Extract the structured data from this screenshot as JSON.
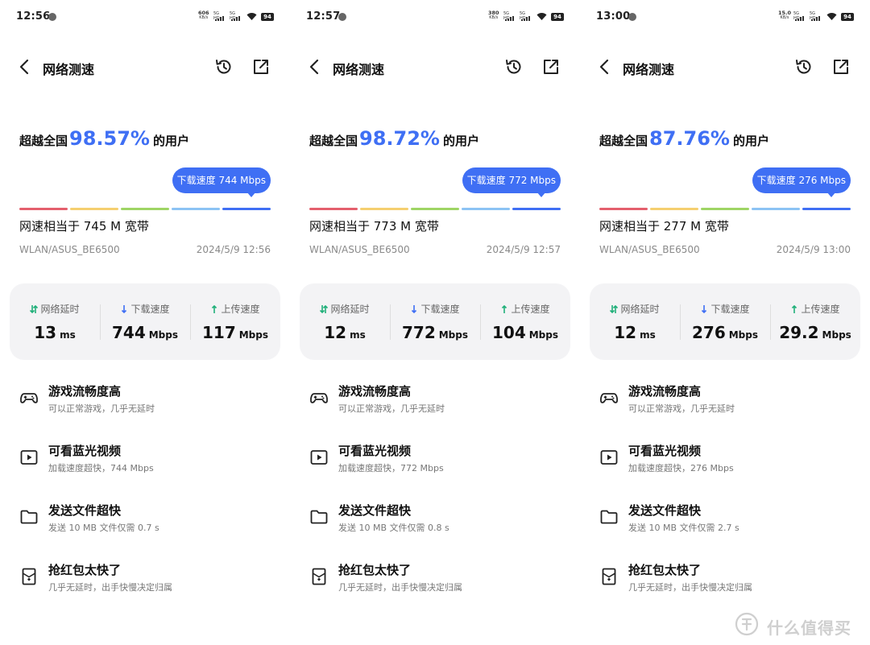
{
  "panels": [
    {
      "status": {
        "time": "12:56",
        "net_speed": "606",
        "net_unit": "KB/s",
        "battery": "94"
      },
      "header": {
        "title": "网络测速"
      },
      "headline": {
        "prefix": "超越全国",
        "percent": "98.57%",
        "suffix": "的用户"
      },
      "bubble": "下载速度 744 Mbps",
      "bandwidth": "网速相当于 745 M 宽带",
      "network": "WLAN/ASUS_BE6500",
      "datetime": "2024/5/9 12:56",
      "stats": {
        "latency_label": "网络延时",
        "latency_value": "13",
        "latency_unit": "ms",
        "download_label": "下载速度",
        "download_value": "744",
        "download_unit": "Mbps",
        "upload_label": "上传速度",
        "upload_value": "117",
        "upload_unit": "Mbps"
      },
      "features": [
        {
          "title": "游戏流畅度高",
          "subtitle": "可以正常游戏，几乎无延时"
        },
        {
          "title": "可看蓝光视频",
          "subtitle": "加载速度超快，744 Mbps"
        },
        {
          "title": "发送文件超快",
          "subtitle": "发送 10 MB 文件仅需 0.7 s"
        },
        {
          "title": "抢红包太快了",
          "subtitle": "几乎无延时，出手快慢决定归属"
        }
      ]
    },
    {
      "status": {
        "time": "12:57",
        "net_speed": "380",
        "net_unit": "KB/s",
        "battery": "94"
      },
      "header": {
        "title": "网络测速"
      },
      "headline": {
        "prefix": "超越全国",
        "percent": "98.72%",
        "suffix": "的用户"
      },
      "bubble": "下载速度 772 Mbps",
      "bandwidth": "网速相当于 773 M 宽带",
      "network": "WLAN/ASUS_BE6500",
      "datetime": "2024/5/9 12:57",
      "stats": {
        "latency_label": "网络延时",
        "latency_value": "12",
        "latency_unit": "ms",
        "download_label": "下载速度",
        "download_value": "772",
        "download_unit": "Mbps",
        "upload_label": "上传速度",
        "upload_value": "104",
        "upload_unit": "Mbps"
      },
      "features": [
        {
          "title": "游戏流畅度高",
          "subtitle": "可以正常游戏，几乎无延时"
        },
        {
          "title": "可看蓝光视频",
          "subtitle": "加载速度超快，772 Mbps"
        },
        {
          "title": "发送文件超快",
          "subtitle": "发送 10 MB 文件仅需 0.8 s"
        },
        {
          "title": "抢红包太快了",
          "subtitle": "几乎无延时，出手快慢决定归属"
        }
      ]
    },
    {
      "status": {
        "time": "13:00",
        "net_speed": "15.0",
        "net_unit": "KB/s",
        "battery": "94"
      },
      "header": {
        "title": "网络测速"
      },
      "headline": {
        "prefix": "超越全国",
        "percent": "87.76%",
        "suffix": "的用户"
      },
      "bubble": "下载速度 276 Mbps",
      "bandwidth": "网速相当于 277 M 宽带",
      "network": "WLAN/ASUS_BE6500",
      "datetime": "2024/5/9 13:00",
      "stats": {
        "latency_label": "网络延时",
        "latency_value": "12",
        "latency_unit": "ms",
        "download_label": "下载速度",
        "download_value": "276",
        "download_unit": "Mbps",
        "upload_label": "上传速度",
        "upload_value": "29.2",
        "upload_unit": "Mbps"
      },
      "features": [
        {
          "title": "游戏流畅度高",
          "subtitle": "可以正常游戏，几乎无延时"
        },
        {
          "title": "可看蓝光视频",
          "subtitle": "加载速度超快，276 Mbps"
        },
        {
          "title": "发送文件超快",
          "subtitle": "发送 10 MB 文件仅需 2.7 s"
        },
        {
          "title": "抢红包太快了",
          "subtitle": "几乎无延时，出手快慢决定归属"
        }
      ]
    }
  ],
  "status_icons": {
    "sig_label": "5G HD"
  },
  "watermark": {
    "text": "什么值得买"
  },
  "colors": {
    "accent": "#3f6ff4",
    "seg_red": "#e45f6d",
    "seg_yellow": "#f5cf70",
    "seg_green": "#9fd565",
    "seg_lightblue": "#8cc3f4",
    "seg_blue": "#3f6ff4",
    "stat_icon_green": "#21b07a",
    "stat_icon_blue": "#3f6ff4"
  },
  "icons": {
    "back": "chevron-left-icon",
    "history": "history-icon",
    "share": "share-external-icon",
    "latency": "latency-arrows-icon",
    "download": "download-arrow-icon",
    "upload": "upload-arrow-icon",
    "feature_0": "gamepad-icon",
    "feature_1": "play-video-icon",
    "feature_2": "folder-icon",
    "feature_3": "red-envelope-icon"
  }
}
